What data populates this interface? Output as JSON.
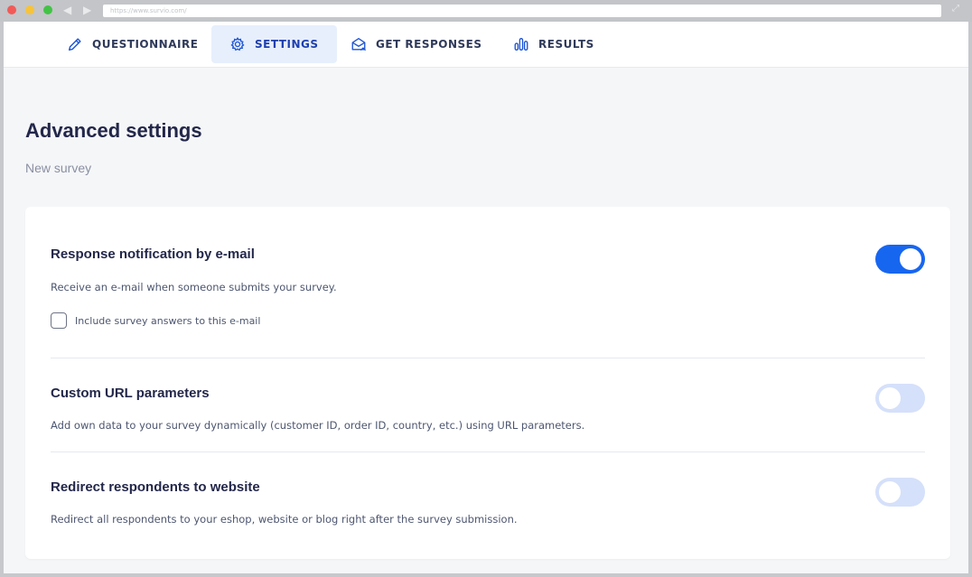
{
  "browser": {
    "url": "https://www.survio.com/"
  },
  "tabs": [
    {
      "label": "QUESTIONNAIRE",
      "icon": "pencil-icon",
      "active": false
    },
    {
      "label": "SETTINGS",
      "icon": "gear-icon",
      "active": true
    },
    {
      "label": "GET RESPONSES",
      "icon": "envelope-send-icon",
      "active": false
    },
    {
      "label": "RESULTS",
      "icon": "bar-chart-icon",
      "active": false
    }
  ],
  "page": {
    "title": "Advanced settings",
    "subtitle": "New survey"
  },
  "settings": [
    {
      "title": "Response notification by e-mail",
      "description": "Receive an e-mail when someone submits your survey.",
      "enabled": true,
      "checkbox_label": "Include survey answers to this e-mail",
      "checkbox_checked": false
    },
    {
      "title": "Custom URL parameters",
      "description": "Add own data to your survey dynamically (customer ID, order ID, country, etc.) using URL parameters.",
      "enabled": false
    },
    {
      "title": "Redirect respondents to website",
      "description": "Redirect all respondents to your eshop, website or blog right after the survey submission.",
      "enabled": false
    }
  ],
  "colors": {
    "accent": "#1766f0",
    "toggle_off": "#d5e0fa",
    "active_tab_bg": "#e7effc",
    "text_dark": "#23274a"
  }
}
